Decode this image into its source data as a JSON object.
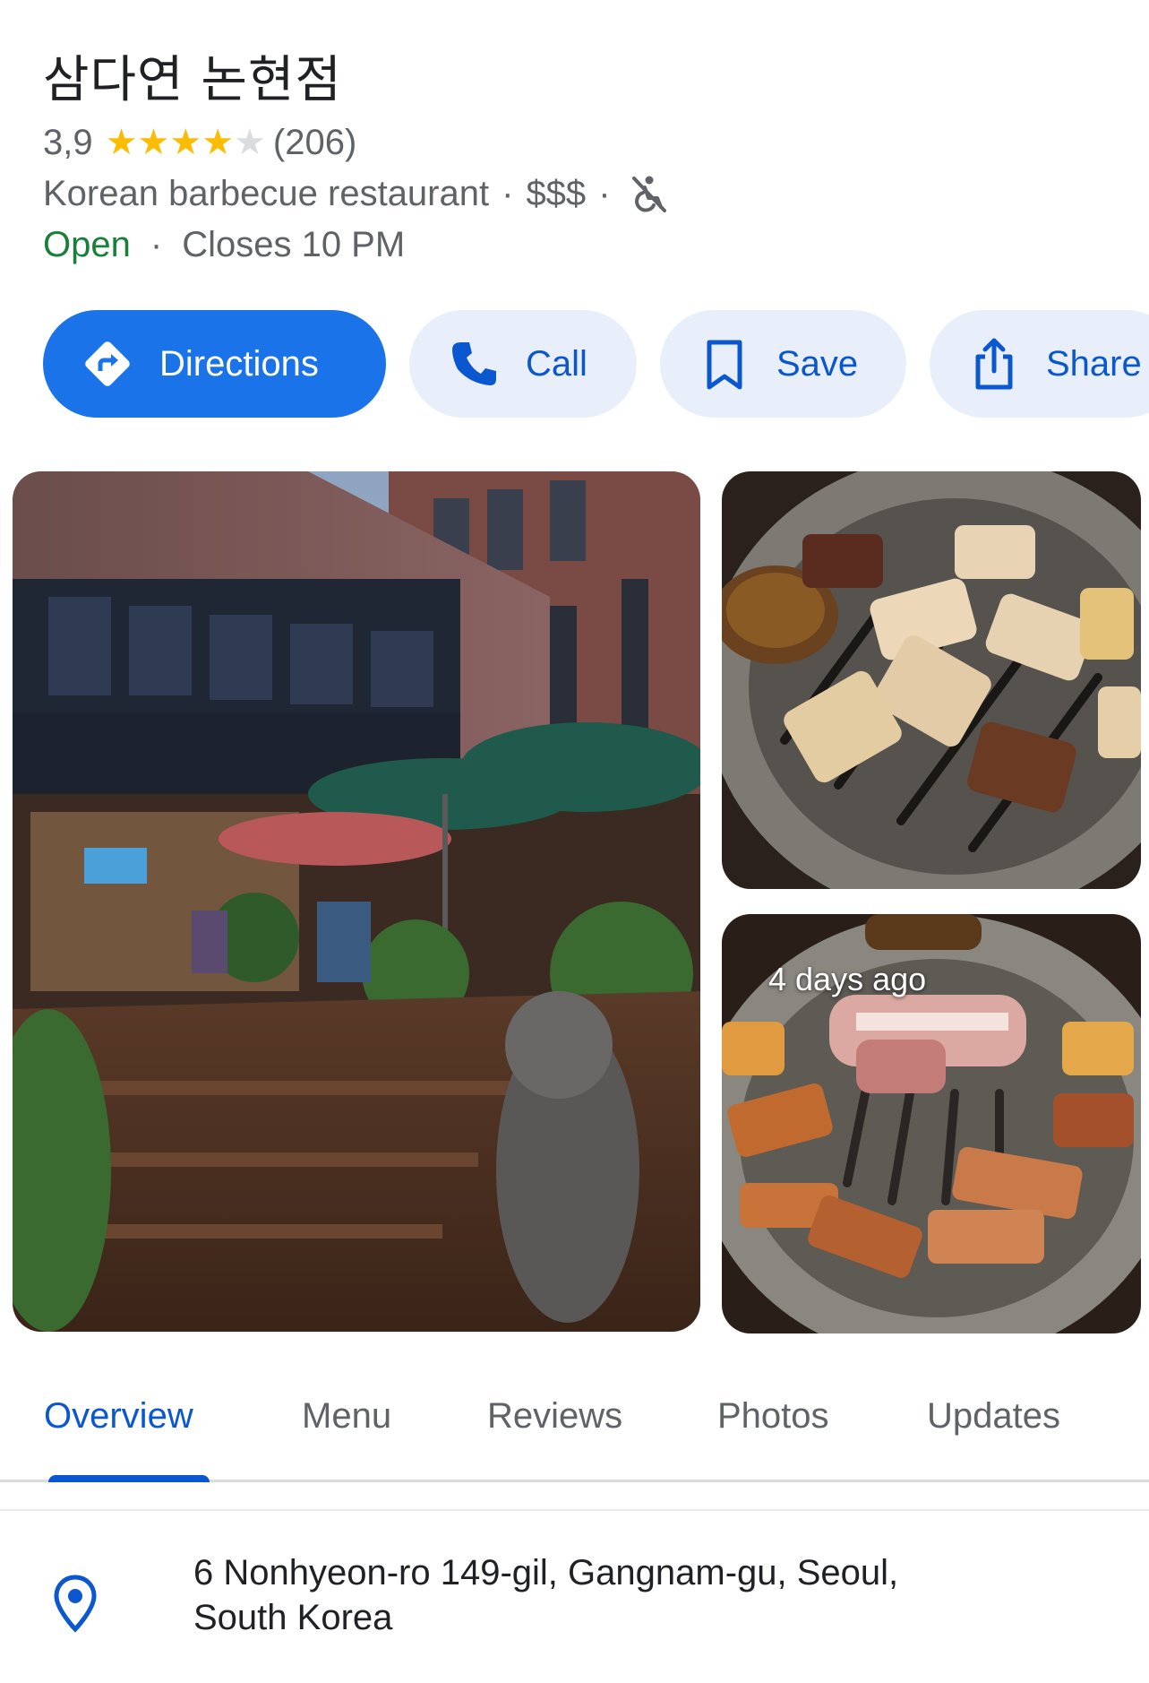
{
  "place": {
    "name": "삼다연 논현점",
    "rating": "3,9",
    "rating_value": 3.9,
    "reviews_count": "(206)",
    "category": "Korean barbecue restaurant",
    "price": "$$$",
    "separator": "·",
    "status_open": "Open",
    "status_closes": "Closes 10 PM"
  },
  "actions": {
    "directions": "Directions",
    "call": "Call",
    "save": "Save",
    "share": "Share"
  },
  "photos": {
    "recent_badge": "4 days ago"
  },
  "tabs": {
    "overview": "Overview",
    "menu": "Menu",
    "reviews": "Reviews",
    "photos": "Photos",
    "updates": "Updates"
  },
  "address": {
    "line1": "6 Nonhyeon-ro 149-gil, Gangnam-gu, Seoul,",
    "line2": "South Korea"
  },
  "colors": {
    "accent": "#0b57d0",
    "primary_button": "#1a73e8",
    "open_green": "#188038",
    "star": "#fbbc04"
  }
}
